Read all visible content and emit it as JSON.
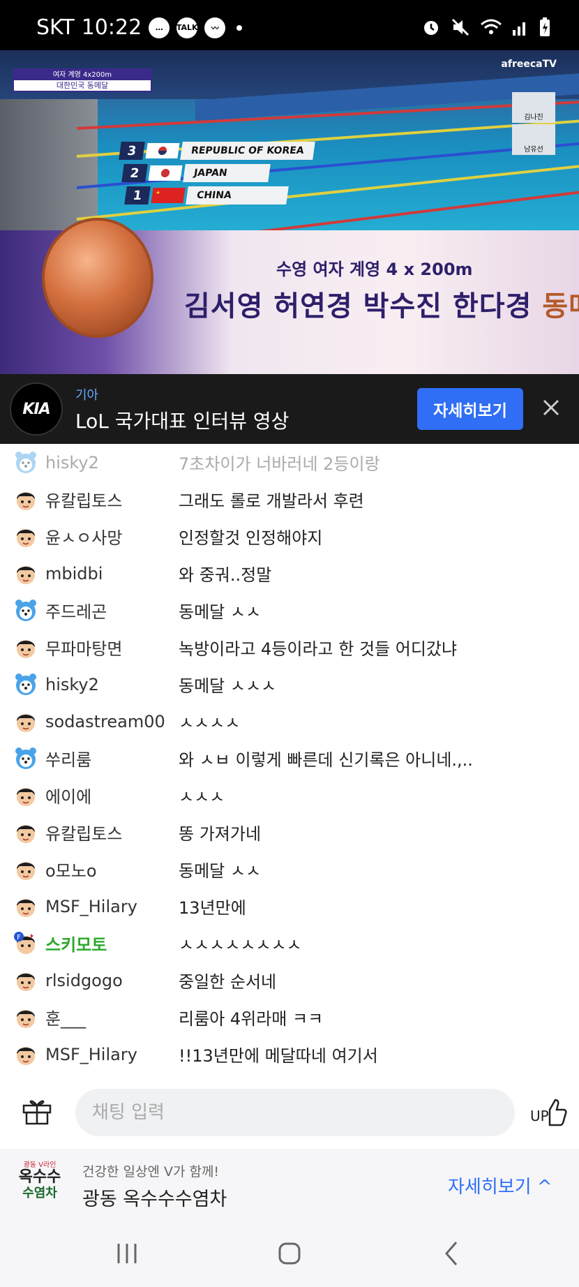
{
  "status": {
    "carrier": "SKT",
    "time": "10:22",
    "talk_badge": "TALK"
  },
  "video": {
    "score_tag": {
      "line1": "여자 계영 4x200m",
      "line2": "대한민국 동메달"
    },
    "logo": "afreecaTV",
    "commentators": [
      "김나진",
      "남유선"
    ],
    "rankings": [
      {
        "rank": "3",
        "country": "REPUBLIC OF KOREA"
      },
      {
        "rank": "2",
        "country": "JAPAN"
      },
      {
        "rank": "1",
        "country": "CHINA"
      }
    ],
    "banner_title": "수영 여자 계영 4 x 200m",
    "banner_names": "김서영 허연경 박수진 한다경",
    "banner_medal": "동메달"
  },
  "ad_top": {
    "brand": "기아",
    "title": "LoL 국가대표 인터뷰 영상",
    "button": "자세히보기",
    "logo_text": "KIA"
  },
  "chat": {
    "messages": [
      {
        "nick": "hisky2",
        "text": "7초차이가 너바러네 2등이랑",
        "avatar": "bear",
        "faded": true
      },
      {
        "nick": "유칼립토스",
        "text": "그래도 롤로 개발라서 후련",
        "avatar": "boy"
      },
      {
        "nick": "윤ㅅㅇ사망",
        "text": "인정할것 인정해야지",
        "avatar": "boy"
      },
      {
        "nick": "mbidbi",
        "text": "와 중궈..정말",
        "avatar": "boy"
      },
      {
        "nick": "주드레곤",
        "text": "동메달 ㅅㅅ",
        "avatar": "bear"
      },
      {
        "nick": "무파마탕면",
        "text": "녹방이라고 4등이라고 한 것들 어디갔냐",
        "avatar": "boy"
      },
      {
        "nick": "hisky2",
        "text": "동메달 ㅅㅅㅅ",
        "avatar": "bear"
      },
      {
        "nick": "sodastream00",
        "text": "ㅅㅅㅅㅅ",
        "avatar": "boy"
      },
      {
        "nick": "쑤리룸",
        "text": "와 ㅅㅂ 이렇게 빠른데 신기록은 아니네.,..",
        "avatar": "bear"
      },
      {
        "nick": "에이에",
        "text": "ㅅㅅㅅ",
        "avatar": "boy"
      },
      {
        "nick": "유칼립토스",
        "text": "똥 가져가네",
        "avatar": "boy"
      },
      {
        "nick": "o모노o",
        "text": "동메달 ㅅㅅ",
        "avatar": "boy"
      },
      {
        "nick": "MSF_Hilary",
        "text": "13년만에",
        "avatar": "boy"
      },
      {
        "nick": "스키모토",
        "text": "ㅅㅅㅅㅅㅅㅅㅅㅅ",
        "avatar": "fan",
        "special": true
      },
      {
        "nick": "rlsidgogo",
        "text": "중일한 순서네",
        "avatar": "boy"
      },
      {
        "nick": "훈___",
        "text": "리룸아 4위라매 ㅋㅋ",
        "avatar": "boy"
      },
      {
        "nick": "MSF_Hilary",
        "text": "!!13년만에 메달따네 여기서",
        "avatar": "boy"
      }
    ],
    "input_placeholder": "채팅 입력",
    "up_label": "UP"
  },
  "ad_bottom": {
    "logo_top": "광동 V라인",
    "logo_mid": "옥수수",
    "logo_bottom": "수염차",
    "subtitle": "건강한 일상엔 V가 함께!",
    "title": "광동 옥수수수염차",
    "more": "자세히보기 ^"
  },
  "colors": {
    "accent": "#2f6ef5",
    "special_nick": "#2aa82a",
    "status_bar": "#000000",
    "ad_bar": "#1a1a1a"
  }
}
